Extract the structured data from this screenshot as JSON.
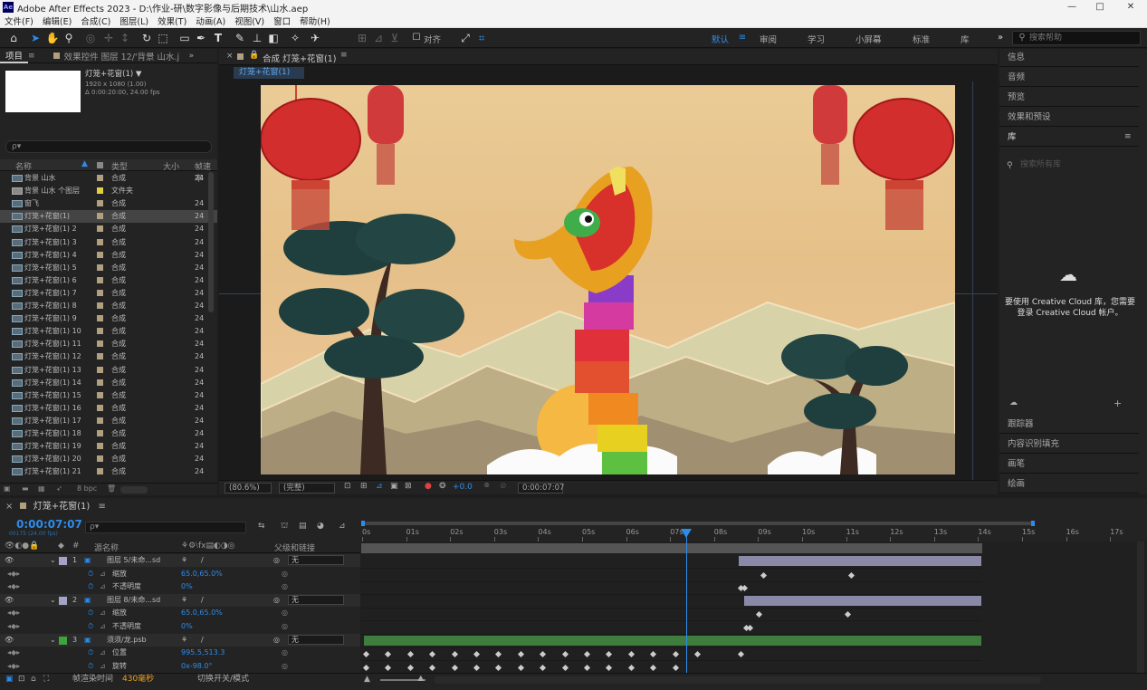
{
  "titlebar": {
    "app_title": "Adobe After Effects 2023 - D:\\作业-研\\数字影像与后期技术\\山水.aep",
    "logo": "Ae",
    "minimize": "—",
    "maximize": "□",
    "close": "✕"
  },
  "menubar": [
    "文件(F)",
    "编辑(E)",
    "合成(C)",
    "图层(L)",
    "效果(T)",
    "动画(A)",
    "视图(V)",
    "窗口",
    "帮助(H)"
  ],
  "toolbar": {
    "align_label": "对齐",
    "workspaces": [
      "默认",
      "审阅",
      "学习",
      "小屏幕",
      "标准",
      "库"
    ],
    "active_workspace": "默认",
    "help_search_placeholder": "搜索帮助"
  },
  "project_panel": {
    "tab_project": "项目",
    "tab_effects": "效果控件 图层 12/'背景 山水.j",
    "comp_name": "灯笼+花窗(1) ▼",
    "comp_res": "1920 x 1080 (1.00)",
    "comp_dur": "Δ 0:00:20:00, 24.00 fps",
    "search_placeholder": "ρ▾",
    "columns": {
      "name": "名称",
      "type": "类型",
      "size": "大小",
      "fps": "帧速率"
    },
    "bpc": "8 bpc",
    "items": [
      {
        "name": "背景 山水",
        "type": "合成",
        "fps": "24",
        "label": "#b0a080"
      },
      {
        "name": "背景 山水 个图层",
        "type": "文件夹",
        "fps": "",
        "label": "#e0d040"
      },
      {
        "name": "窗飞",
        "type": "合成",
        "fps": "24",
        "label": "#b0a080"
      },
      {
        "name": "灯笼+花窗(1)",
        "type": "合成",
        "fps": "24",
        "label": "#b0a080"
      },
      {
        "name": "灯笼+花窗(1) 2",
        "type": "合成",
        "fps": "24",
        "label": "#b0a080"
      },
      {
        "name": "灯笼+花窗(1) 3",
        "type": "合成",
        "fps": "24",
        "label": "#b0a080"
      },
      {
        "name": "灯笼+花窗(1) 4",
        "type": "合成",
        "fps": "24",
        "label": "#b0a080"
      },
      {
        "name": "灯笼+花窗(1) 5",
        "type": "合成",
        "fps": "24",
        "label": "#b0a080"
      },
      {
        "name": "灯笼+花窗(1) 6",
        "type": "合成",
        "fps": "24",
        "label": "#b0a080"
      },
      {
        "name": "灯笼+花窗(1) 7",
        "type": "合成",
        "fps": "24",
        "label": "#b0a080"
      },
      {
        "name": "灯笼+花窗(1) 8",
        "type": "合成",
        "fps": "24",
        "label": "#b0a080"
      },
      {
        "name": "灯笼+花窗(1) 9",
        "type": "合成",
        "fps": "24",
        "label": "#b0a080"
      },
      {
        "name": "灯笼+花窗(1) 10",
        "type": "合成",
        "fps": "24",
        "label": "#b0a080"
      },
      {
        "name": "灯笼+花窗(1) 11",
        "type": "合成",
        "fps": "24",
        "label": "#b0a080"
      },
      {
        "name": "灯笼+花窗(1) 12",
        "type": "合成",
        "fps": "24",
        "label": "#b0a080"
      },
      {
        "name": "灯笼+花窗(1) 13",
        "type": "合成",
        "fps": "24",
        "label": "#b0a080"
      },
      {
        "name": "灯笼+花窗(1) 14",
        "type": "合成",
        "fps": "24",
        "label": "#b0a080"
      },
      {
        "name": "灯笼+花窗(1) 15",
        "type": "合成",
        "fps": "24",
        "label": "#b0a080"
      },
      {
        "name": "灯笼+花窗(1) 16",
        "type": "合成",
        "fps": "24",
        "label": "#b0a080"
      },
      {
        "name": "灯笼+花窗(1) 17",
        "type": "合成",
        "fps": "24",
        "label": "#b0a080"
      },
      {
        "name": "灯笼+花窗(1) 18",
        "type": "合成",
        "fps": "24",
        "label": "#b0a080"
      },
      {
        "name": "灯笼+花窗(1) 19",
        "type": "合成",
        "fps": "24",
        "label": "#b0a080"
      },
      {
        "name": "灯笼+花窗(1) 20",
        "type": "合成",
        "fps": "24",
        "label": "#b0a080"
      },
      {
        "name": "灯笼+花窗(1) 21",
        "type": "合成",
        "fps": "24",
        "label": "#b0a080"
      }
    ]
  },
  "composition": {
    "tab_label": "合成 灯笼+花窗(1)",
    "crumb": "灯笼+花窗(1)",
    "zoom": "(80.6%)",
    "resolution": "(完整)",
    "exposure": "+0.0",
    "timecode": "0:00:07:07"
  },
  "right_panels": {
    "items": [
      "信息",
      "音频",
      "预览",
      "效果和预设",
      "库"
    ],
    "lib_search": "搜索所有库",
    "lib_msg": "要使用 Creative Cloud 库，您需要登录 Creative Cloud 帐户。",
    "bottom_items": [
      "跟踪器",
      "内容识别填充",
      "画笔",
      "绘画"
    ]
  },
  "timeline": {
    "tab": "灯笼+花窗(1)",
    "current_time": "0:00:07:07",
    "frame_info": "00175 (24.00 fps)",
    "search_placeholder": "ρ▾",
    "col_source": "源名称",
    "col_parent": "父级和链接",
    "ruler": [
      "0s",
      "01s",
      "02s",
      "03s",
      "04s",
      "05s",
      "06s",
      "07s",
      "08s",
      "09s",
      "10s",
      "11s",
      "12s",
      "13s",
      "14s",
      "15s",
      "16s",
      "17s"
    ],
    "rows": [
      {
        "kind": "layer",
        "num": "1",
        "name": "图层 5/未命...sd",
        "parent": "无",
        "color": "#a3a3c8"
      },
      {
        "kind": "prop",
        "name": "缩放",
        "value": "65.0,65.0%"
      },
      {
        "kind": "prop",
        "name": "不透明度",
        "value": "0%"
      },
      {
        "kind": "layer",
        "num": "2",
        "name": "图层 8/未命...sd",
        "parent": "无",
        "color": "#a3a3c8"
      },
      {
        "kind": "prop",
        "name": "缩放",
        "value": "65.0,65.0%"
      },
      {
        "kind": "prop",
        "name": "不透明度",
        "value": "0%"
      },
      {
        "kind": "layer",
        "num": "3",
        "name": "须须/龙.psb",
        "parent": "无",
        "color": "#3ea33e"
      },
      {
        "kind": "prop",
        "name": "位置",
        "value": "995.5,513.3"
      },
      {
        "kind": "prop",
        "name": "旋转",
        "value": "0x-98.0°"
      }
    ],
    "render_label": "帧渲染时间",
    "render_time": "430毫秒",
    "toggle_label": "切换开关/模式"
  }
}
